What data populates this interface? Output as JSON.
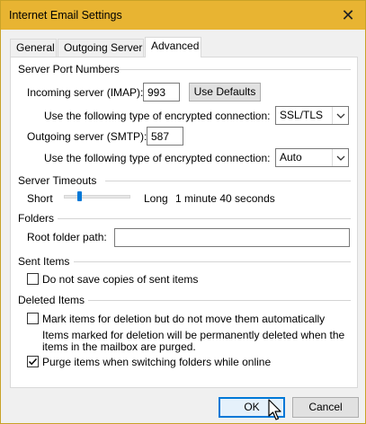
{
  "window": {
    "title": "Internet Email Settings",
    "close_glyph": "✕"
  },
  "tabs": [
    {
      "label": "General",
      "active": false
    },
    {
      "label": "Outgoing Server",
      "active": false
    },
    {
      "label": "Advanced",
      "active": true
    }
  ],
  "server_ports": {
    "heading": "Server Port Numbers",
    "incoming_label": "Incoming server (IMAP):",
    "incoming_value": "993",
    "use_defaults_label": "Use Defaults",
    "incoming_enc_label": "Use the following type of encrypted connection:",
    "incoming_enc_value": "SSL/TLS",
    "outgoing_label": "Outgoing server (SMTP):",
    "outgoing_value": "587",
    "outgoing_enc_label": "Use the following type of encrypted connection:",
    "outgoing_enc_value": "Auto"
  },
  "timeouts": {
    "heading": "Server Timeouts",
    "short_label": "Short",
    "long_label": "Long",
    "value_text": "1 minute 40 seconds",
    "slider_fraction": 0.2
  },
  "folders": {
    "heading": "Folders",
    "root_label": "Root folder path:",
    "root_value": ""
  },
  "sent_items": {
    "heading": "Sent Items",
    "no_copies_label": "Do not save copies of sent items",
    "no_copies_checked": false
  },
  "deleted_items": {
    "heading": "Deleted Items",
    "mark_label": "Mark items for deletion but do not move them automatically",
    "mark_checked": false,
    "note_line1": "Items marked for deletion will be permanently deleted when the",
    "note_line2": "items in the mailbox are purged.",
    "purge_label": "Purge items when switching folders while online",
    "purge_checked": true
  },
  "footer": {
    "ok_label": "OK",
    "cancel_label": "Cancel"
  },
  "colors": {
    "titlebar": "#e8b432",
    "accent": "#0078d7"
  },
  "icons": [
    "close-icon",
    "chevron-down-icon",
    "checkmark-icon",
    "mouse-pointer-icon"
  ]
}
